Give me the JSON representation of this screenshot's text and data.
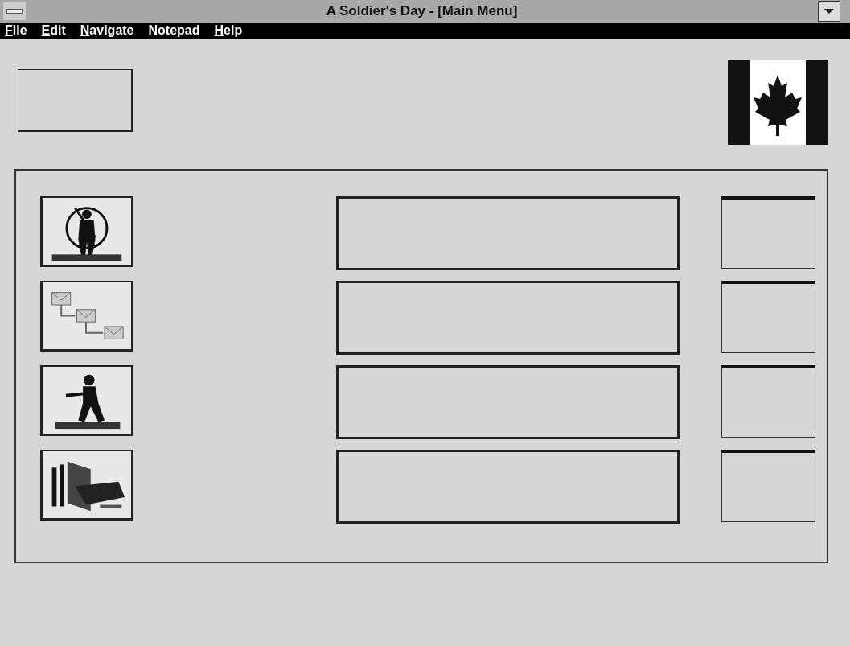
{
  "window": {
    "title": "A Soldier's Day - [Main Menu]"
  },
  "menu": [
    {
      "label": "File",
      "underlined_first": true
    },
    {
      "label": "Edit",
      "underlined_first": true
    },
    {
      "label": "Navigate",
      "underlined_first": true
    },
    {
      "label": "Notepad",
      "underlined_first": false
    },
    {
      "label": "Help",
      "underlined_first": true
    }
  ],
  "rows": [
    {
      "kind": "sentry"
    },
    {
      "kind": "messages"
    },
    {
      "kind": "patrol"
    },
    {
      "kind": "study"
    }
  ]
}
